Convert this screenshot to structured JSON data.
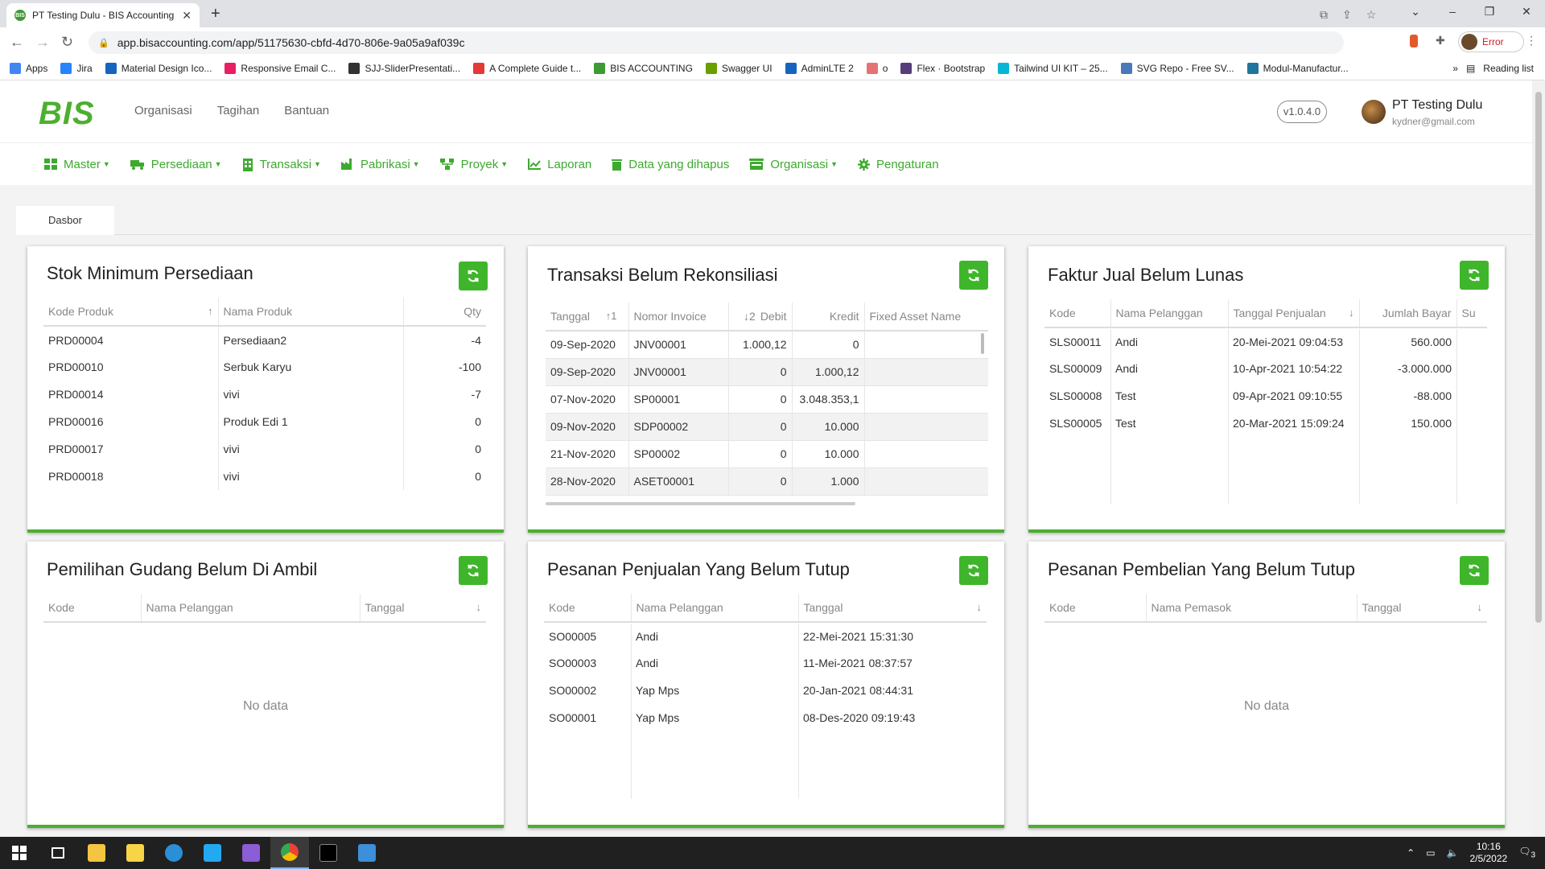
{
  "browser": {
    "tab_title": "PT Testing Dulu - BIS Accounting",
    "favicon_text": "BIS",
    "url": "app.bisaccounting.com/app/51175630-cbfd-4d70-806e-9a05a9af039c",
    "profile_status": "Error",
    "bookmarks": [
      {
        "label": "Apps",
        "color": "#4285f4"
      },
      {
        "label": "Jira",
        "color": "#2684ff"
      },
      {
        "label": "Material Design Ico...",
        "color": "#1565c0"
      },
      {
        "label": "Responsive Email C...",
        "color": "#e91e63"
      },
      {
        "label": "SJJ-SliderPresentati...",
        "color": "#333333"
      },
      {
        "label": "A Complete Guide t...",
        "color": "#e53935"
      },
      {
        "label": "BIS ACCOUNTING",
        "color": "#3d9a34"
      },
      {
        "label": "Swagger UI",
        "color": "#6a9f00"
      },
      {
        "label": "AdminLTE 2",
        "color": "#1565c0"
      },
      {
        "label": "o",
        "color": "#e57373"
      },
      {
        "label": "Flex · Bootstrap",
        "color": "#563d7c"
      },
      {
        "label": "Tailwind UI KIT – 25...",
        "color": "#06b6d4"
      },
      {
        "label": "SVG Repo - Free SV...",
        "color": "#4a78b8"
      },
      {
        "label": "Modul-Manufactur...",
        "color": "#21759b"
      }
    ],
    "reading_list": "Reading list",
    "more": "»"
  },
  "app": {
    "logo": "BIS",
    "top_nav": [
      "Organisasi",
      "Tagihan",
      "Bantuan"
    ],
    "version": "v1.0.4.0",
    "user_name": "PT Testing Dulu",
    "user_email": "kydner@gmail.com",
    "accent_color": "#3daa2f",
    "menu": [
      {
        "label": "Master",
        "icon": "grid-icon",
        "dropdown": true
      },
      {
        "label": "Persediaan",
        "icon": "truck-icon",
        "dropdown": true
      },
      {
        "label": "Transaksi",
        "icon": "building-icon",
        "dropdown": true
      },
      {
        "label": "Pabrikasi",
        "icon": "factory-icon",
        "dropdown": true
      },
      {
        "label": "Proyek",
        "icon": "sitemap-icon",
        "dropdown": true
      },
      {
        "label": "Laporan",
        "icon": "chart-icon",
        "dropdown": false
      },
      {
        "label": "Data yang dihapus",
        "icon": "trash-icon",
        "dropdown": false
      },
      {
        "label": "Organisasi",
        "icon": "bank-icon",
        "dropdown": true
      },
      {
        "label": "Pengaturan",
        "icon": "gear-icon",
        "dropdown": false
      }
    ],
    "active_tab": "Dasbor"
  },
  "panels": {
    "stok": {
      "title": "Stok Minimum Persediaan",
      "headers": [
        "Kode Produk",
        "Nama Produk",
        "Qty"
      ],
      "sort_icon": "↑",
      "rows": [
        [
          "PRD00004",
          "Persediaan2",
          "-4"
        ],
        [
          "PRD00010",
          "Serbuk Karyu",
          "-100"
        ],
        [
          "PRD00014",
          "vivi",
          "-7"
        ],
        [
          "PRD00016",
          "Produk Edi 1",
          "0"
        ],
        [
          "PRD00017",
          "vivi",
          "0"
        ],
        [
          "PRD00018",
          "vivi",
          "0"
        ]
      ]
    },
    "rekon": {
      "title": "Transaksi Belum Rekonsiliasi",
      "headers": [
        "Tanggal",
        "Nomor Invoice",
        "Debit",
        "Kredit",
        "Fixed Asset Name"
      ],
      "sort_tanggal": "↑1",
      "sort_debit": "↓2",
      "rows": [
        [
          "09-Sep-2020",
          "JNV00001",
          "1.000,12",
          "0",
          ""
        ],
        [
          "09-Sep-2020",
          "JNV00001",
          "0",
          "1.000,12",
          ""
        ],
        [
          "07-Nov-2020",
          "SP00001",
          "0",
          "3.048.353,1",
          ""
        ],
        [
          "09-Nov-2020",
          "SDP00002",
          "0",
          "10.000",
          ""
        ],
        [
          "21-Nov-2020",
          "SP00002",
          "0",
          "10.000",
          ""
        ],
        [
          "28-Nov-2020",
          "ASET00001",
          "0",
          "1.000",
          ""
        ]
      ]
    },
    "faktur": {
      "title": "Faktur Jual Belum Lunas",
      "headers": [
        "Kode",
        "Nama Pelanggan",
        "Tanggal Penjualan",
        "Jumlah Bayar",
        "Su"
      ],
      "sort_icon": "↓",
      "rows": [
        [
          "SLS00011",
          "Andi",
          "20-Mei-2021 09:04:53",
          "560.000",
          ""
        ],
        [
          "SLS00009",
          "Andi",
          "10-Apr-2021 10:54:22",
          "-3.000.000",
          ""
        ],
        [
          "SLS00008",
          "Test",
          "09-Apr-2021 09:10:55",
          "-88.000",
          ""
        ],
        [
          "SLS00005",
          "Test",
          "20-Mar-2021 15:09:24",
          "150.000",
          ""
        ]
      ]
    },
    "gudang": {
      "title": "Pemilihan Gudang Belum Di Ambil",
      "headers": [
        "Kode",
        "Nama Pelanggan",
        "Tanggal"
      ],
      "sort_icon": "↓",
      "empty": "No data"
    },
    "penjualan": {
      "title": "Pesanan Penjualan Yang Belum Tutup",
      "headers": [
        "Kode",
        "Nama Pelanggan",
        "Tanggal"
      ],
      "sort_icon": "↓",
      "rows": [
        [
          "SO00005",
          "Andi",
          "22-Mei-2021 15:31:30"
        ],
        [
          "SO00003",
          "Andi",
          "11-Mei-2021 08:37:57"
        ],
        [
          "SO00002",
          "Yap Mps",
          "20-Jan-2021 08:44:31"
        ],
        [
          "SO00001",
          "Yap Mps",
          "08-Des-2020 09:19:43"
        ]
      ]
    },
    "pembelian": {
      "title": "Pesanan Pembelian Yang Belum Tutup",
      "headers": [
        "Kode",
        "Nama Pemasok",
        "Tanggal"
      ],
      "sort_icon": "↓",
      "empty": "No data"
    }
  },
  "taskbar": {
    "time": "10:16",
    "date": "2/5/2022",
    "notifications": "3"
  }
}
